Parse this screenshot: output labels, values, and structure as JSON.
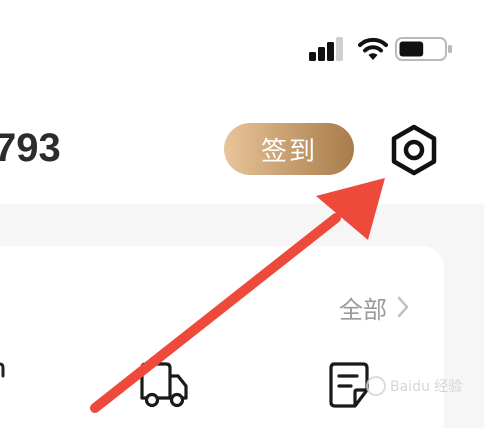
{
  "status_bar": {
    "signal_icon": "signal-bars-icon",
    "wifi_icon": "wifi-icon",
    "battery_icon": "battery-icon",
    "battery_level": 0.55
  },
  "header": {
    "user_number": "793",
    "checkin_label": "签到",
    "settings_icon": "gear-icon"
  },
  "orders": {
    "see_all_label": "全部",
    "chevron_icon": "chevron-right-icon",
    "items": [
      {
        "icon": "truck-icon"
      },
      {
        "icon": "review-icon"
      }
    ]
  },
  "annotation": {
    "color": "#ee4a3c"
  },
  "watermark": {
    "text": "Baidu 经验"
  },
  "colors": {
    "checkin_gradient_start": "#e7c699",
    "checkin_gradient_end": "#a97c4b",
    "page_gray": "#f6f6f6",
    "muted_text": "#9a9a9a"
  }
}
